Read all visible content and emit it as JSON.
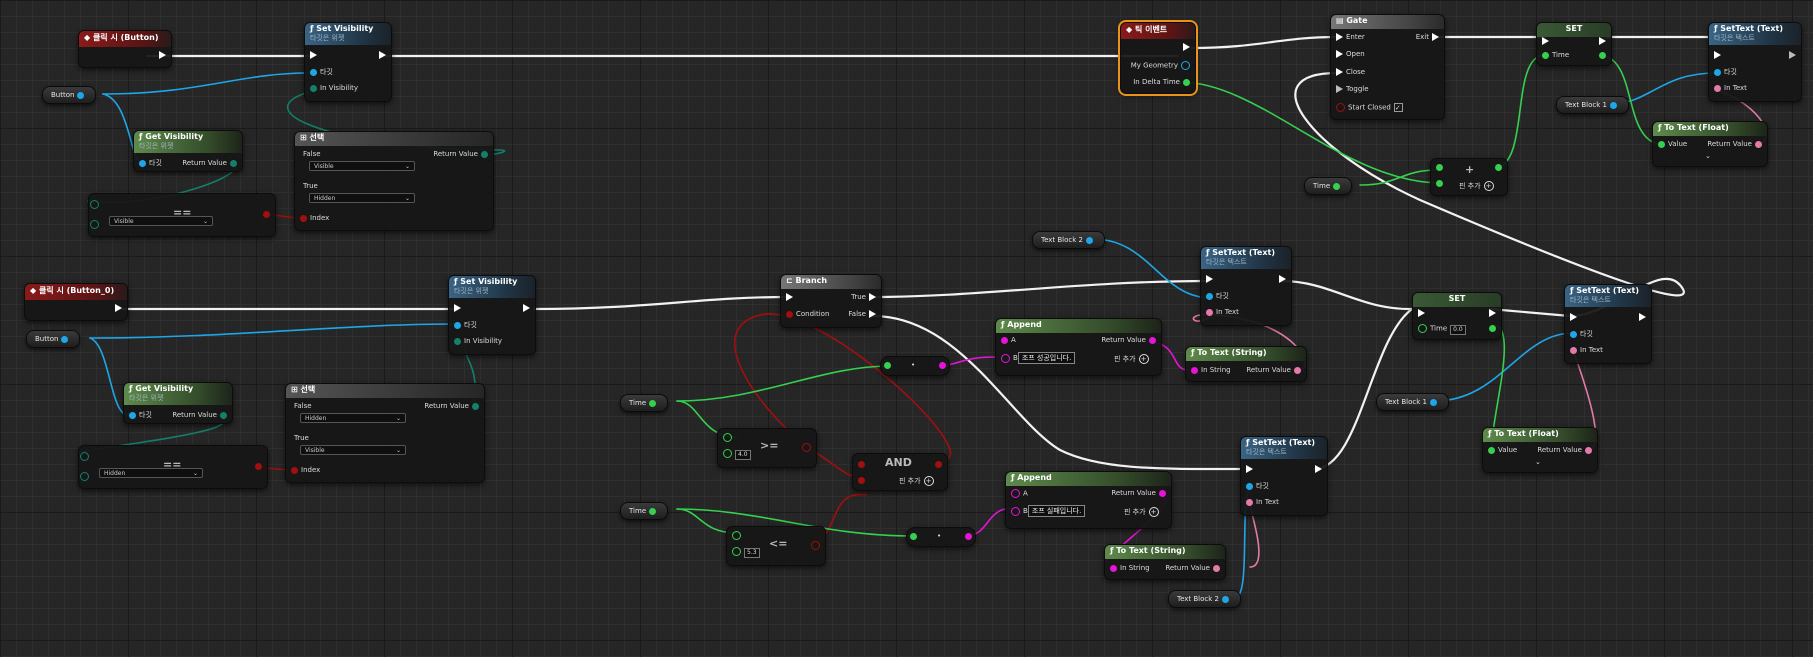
{
  "colors": {
    "exec": "#ffffff",
    "object": "#1ea7e8",
    "enum": "#14806b",
    "bool": "#a10f0f",
    "float": "#35d04f",
    "string": "#e514d8",
    "text": "#e37aa8",
    "selection": "#e8941a"
  },
  "icons": {
    "event": "event-diamond-icon",
    "function": "function-f-icon",
    "exec": "exec-arrow-icon",
    "add": "add-pin-plus-icon",
    "select": "select-icon",
    "branch": "branch-icon",
    "gate": "gate-icon"
  },
  "events": {
    "click_button": "클릭 시 (Button)",
    "click_button0": "클릭 시 (Button_0)",
    "tick": "틱 이벤트"
  },
  "tick_pins": {
    "geometry": "My Geometry",
    "delta": "In Delta Time"
  },
  "setvis": {
    "title": "Set Visibility",
    "sub": "타깃은 위젯",
    "target": "타깃",
    "in_vis": "In Visibility"
  },
  "getvis": {
    "title": "Get Visibility",
    "sub": "타깃은 위젯",
    "target": "타깃",
    "ret": "Return Value"
  },
  "select": {
    "title": "선택",
    "false_label": "False",
    "true_label": "True",
    "index": "Index",
    "ret": "Return Value",
    "top_false_value": "Visible",
    "top_true_value": "Hidden",
    "bottom_false_value": "Hidden",
    "bottom_true_value": "Visible"
  },
  "equal": {
    "symbol": "==",
    "top_value": "Visible",
    "bottom_value": "Hidden"
  },
  "vars": {
    "button": "Button",
    "time": "Time",
    "text_block_1": "Text Block 1",
    "text_block_2": "Text Block 2"
  },
  "gate": {
    "title": "Gate",
    "enter": "Enter",
    "open": "Open",
    "close": "Close",
    "toggle": "Toggle",
    "start_closed": "Start Closed",
    "exit": "Exit"
  },
  "set": {
    "title": "SET",
    "time": "Time",
    "time_value": "0.0"
  },
  "settext": {
    "title": "SetText (Text)",
    "sub": "타깃은 텍스트",
    "target": "타깃",
    "in_text": "In Text"
  },
  "totext_float": {
    "title": "To Text (Float)",
    "value": "Value",
    "ret": "Return Value",
    "expand": "⌄"
  },
  "totext_string": {
    "title": "To Text (String)",
    "in_string": "In String",
    "ret": "Return Value"
  },
  "add_node": {
    "symbol": "+",
    "add_pin": "핀 추가"
  },
  "branch": {
    "title": "Branch",
    "condition": "Condition",
    "true_label": "True",
    "false_label": "False"
  },
  "append": {
    "title": "Append",
    "a": "A",
    "b": "B",
    "ret": "Return Value",
    "add_pin": "핀 추가",
    "success": "조프 성공입니다.",
    "fail": "조프 실패입니다."
  },
  "compare": {
    "gte": ">=",
    "lte": "<=",
    "gte_value": "4.0",
    "lte_value": "5.3"
  },
  "and_node": {
    "label": "AND",
    "add_pin": "핀 추가"
  },
  "convert_symbol": "•"
}
